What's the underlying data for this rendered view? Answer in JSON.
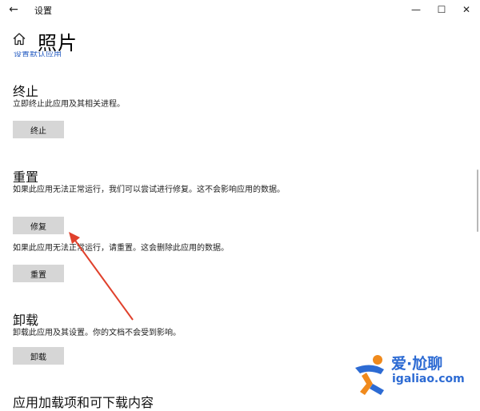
{
  "window": {
    "title": "设置",
    "back_glyph": "←",
    "minimize_glyph": "—",
    "maximize_glyph": "☐",
    "close_glyph": "✕"
  },
  "page": {
    "title": "照片",
    "cut_link": "设置默认应用"
  },
  "terminate": {
    "title": "终止",
    "desc": "立即终止此应用及其相关进程。",
    "button": "终止"
  },
  "reset": {
    "title": "重置",
    "repair_desc": "如果此应用无法正常运行，我们可以尝试进行修复。这不会影响应用的数据。",
    "repair_button": "修复",
    "reset_desc": "如果此应用无法正常运行，请重置。这会删除此应用的数据。",
    "reset_button": "重置"
  },
  "uninstall": {
    "title": "卸载",
    "desc": "卸载此应用及其设置。你的文档不会受到影响。",
    "button": "卸载"
  },
  "next_section": {
    "title": "应用加载项和可下载内容"
  },
  "watermark": {
    "brand": "爱·尬聊",
    "url": "igaliao.com"
  },
  "colors": {
    "accent_link": "#2b60c3",
    "button_bg": "#d6d6d6",
    "arrow": "#e0412c",
    "watermark_blue": "#2d6bd3",
    "watermark_orange": "#f08a1c"
  }
}
